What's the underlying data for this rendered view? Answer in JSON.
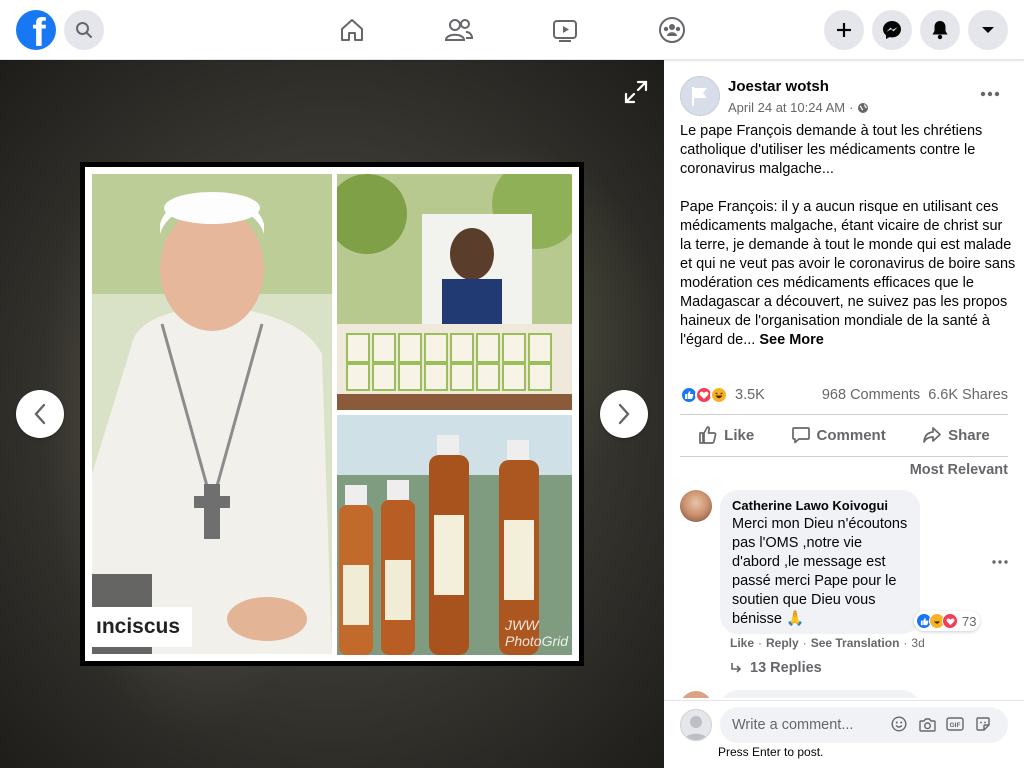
{
  "colors": {
    "brand": "#1877f2",
    "like": "#1877f2",
    "love": "#f33e58",
    "haha": "#f7b125",
    "secondary_text": "#65676b"
  },
  "topbar": {
    "logo_letter": "f",
    "icons": [
      "search-icon",
      "home-icon",
      "friends-icon",
      "watch-icon",
      "groups-icon",
      "plus-icon",
      "messenger-icon",
      "bell-icon",
      "caret-down-icon"
    ]
  },
  "photo": {
    "caption_fragment": "ınciscus",
    "watermark": "JWW PhotoGrid"
  },
  "post": {
    "author": "Joestar wotsh",
    "timestamp": "April 24 at 10:24 AM",
    "text": "Le pape François demande à tout les chrétiens catholique d'utiliser les médicaments contre le coronavirus malgache...\n\nPape François: il y a aucun risque en utilisant ces médicaments malgache, étant vicaire de christ sur la terre, je demande à tout le monde qui est malade et qui ne veut pas avoir le coronavirus de boire sans modération ces médicaments efficaces que le Madagascar a découvert, ne suivez pas les propos haineux de l'organisation mondiale de la santé à l'égard de...",
    "see_more": "See More",
    "reaction_count": "3.5K",
    "comments_count": "968 Comments",
    "shares_count": "6.6K Shares",
    "actions": {
      "like": "Like",
      "comment": "Comment",
      "share": "Share"
    },
    "sort_label": "Most Relevant"
  },
  "comment": {
    "name": "Catherine Lawo Koivogui",
    "text": "Merci mon Dieu n'écoutons pas l'OMS ,notre vie d'abord ,le message est passé merci Pape pour le soutien que Dieu vous bénisse 🙏",
    "reaction_count": "73",
    "like": "Like",
    "reply": "Reply",
    "see_translation": "See Translation",
    "time": "3d",
    "replies": "13 Replies"
  },
  "composer": {
    "placeholder": "Write a comment...",
    "hint": "Press Enter to post."
  }
}
